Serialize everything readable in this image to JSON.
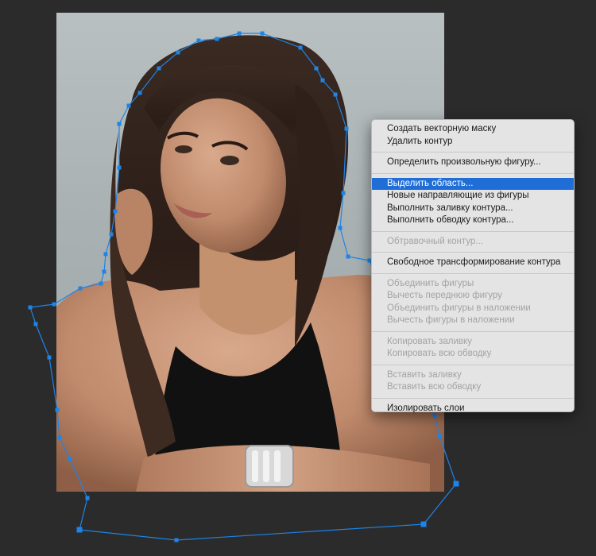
{
  "canvas": {
    "background_color": "#2b2b2b",
    "path_color": "#1e84e8"
  },
  "photo": {
    "description_icon": "portrait-photo-icon"
  },
  "context_menu": {
    "groups": [
      {
        "items": [
          {
            "label": "Создать векторную маску",
            "enabled": true
          },
          {
            "label": "Удалить контур",
            "enabled": true
          }
        ]
      },
      {
        "items": [
          {
            "label": "Определить произвольную фигуру...",
            "enabled": true
          }
        ]
      },
      {
        "items": [
          {
            "label": "Выделить область...",
            "enabled": true,
            "selected": true
          },
          {
            "label": "Новые направляющие из фигуры",
            "enabled": true
          },
          {
            "label": "Выполнить заливку контура...",
            "enabled": true
          },
          {
            "label": "Выполнить обводку контура...",
            "enabled": true
          }
        ]
      },
      {
        "items": [
          {
            "label": "Обтравочный контур...",
            "enabled": false
          }
        ]
      },
      {
        "items": [
          {
            "label": "Свободное трансформирование контура",
            "enabled": true
          }
        ]
      },
      {
        "items": [
          {
            "label": "Объединить фигуры",
            "enabled": false
          },
          {
            "label": "Вычесть переднюю фигуру",
            "enabled": false
          },
          {
            "label": "Объединить фигуры в наложении",
            "enabled": false
          },
          {
            "label": "Вычесть фигуры в наложении",
            "enabled": false
          }
        ]
      },
      {
        "items": [
          {
            "label": "Копировать заливку",
            "enabled": false
          },
          {
            "label": "Копировать всю обводку",
            "enabled": false
          }
        ]
      },
      {
        "items": [
          {
            "label": "Вставить заливку",
            "enabled": false
          },
          {
            "label": "Вставить всю обводку",
            "enabled": false
          }
        ]
      },
      {
        "items": [
          {
            "label": "Изолировать слои",
            "enabled": true
          }
        ]
      }
    ]
  }
}
